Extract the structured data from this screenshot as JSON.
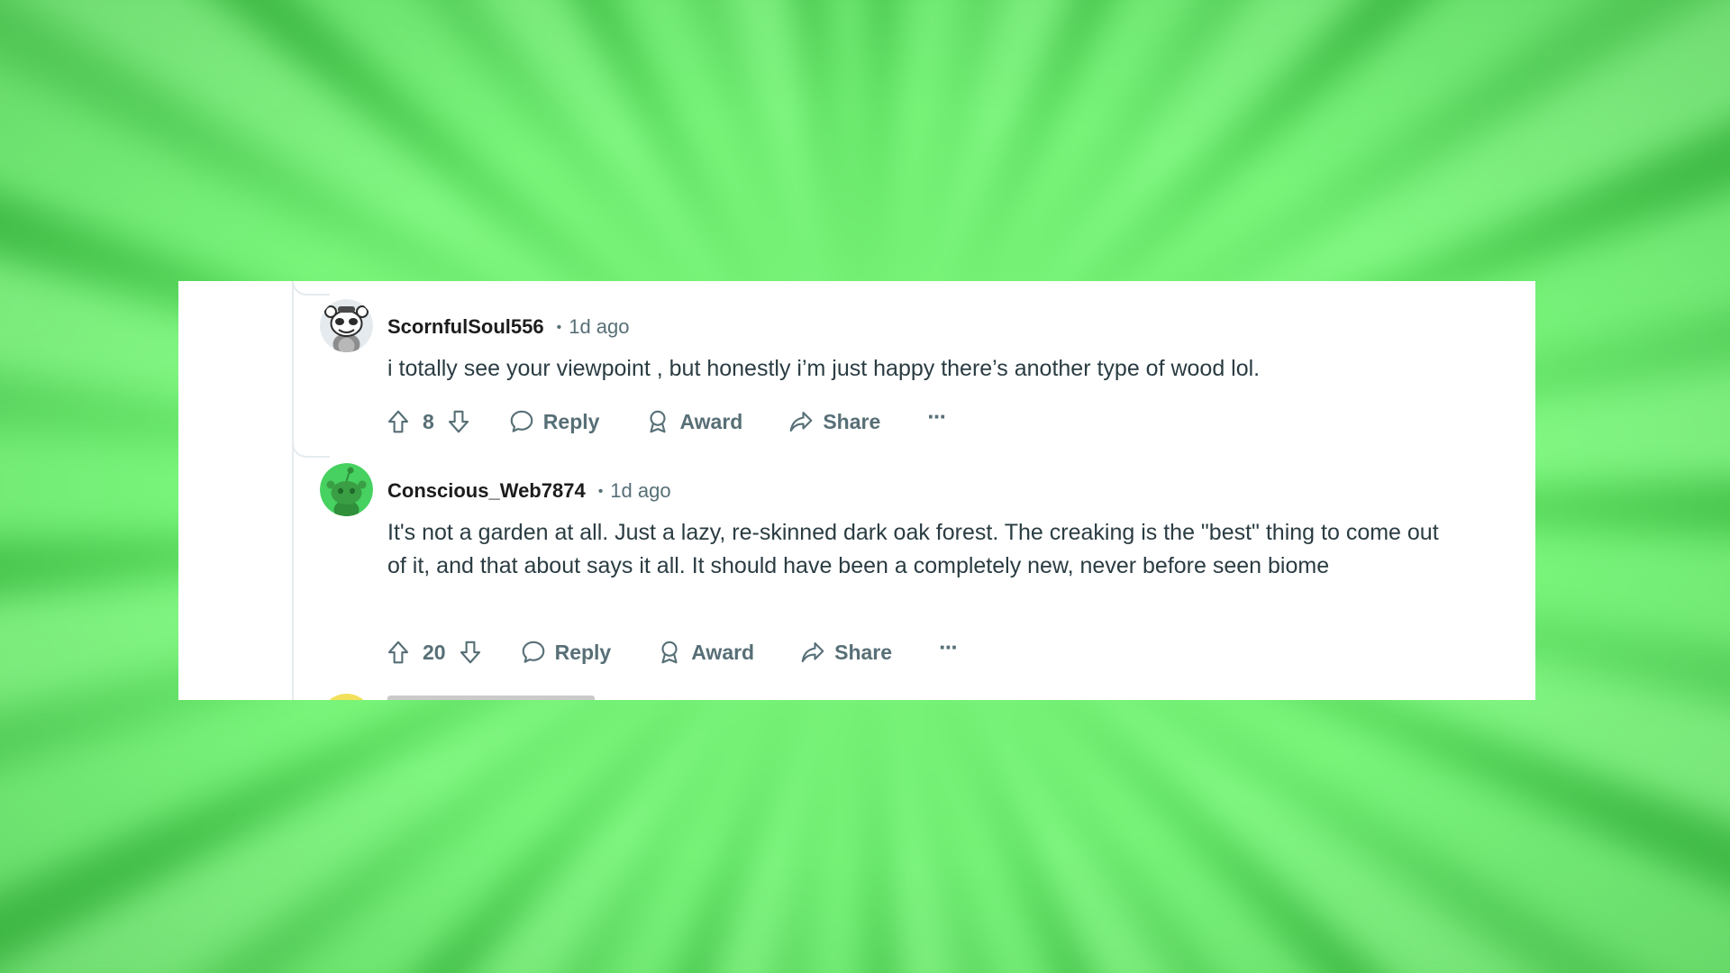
{
  "comments": [
    {
      "username": "ScornfulSoul556",
      "separator": "•",
      "time": "1d ago",
      "body": "i totally see your viewpoint , but honestly i’m just happy there’s another type of wood lol.",
      "votes": "8",
      "reply_label": "Reply",
      "award_label": "Award",
      "share_label": "Share",
      "more_label": "···",
      "avatar_icon": "robot-snoo-avatar-icon"
    },
    {
      "username": "Conscious_Web7874",
      "separator": "•",
      "time": "1d ago",
      "body": "It's not a garden at all. Just a lazy, re-skinned dark oak forest. The creaking is the \"best\" thing to come out of it, and that about says it all. It should have been a completely new, never before seen biome",
      "votes": "20",
      "reply_label": "Reply",
      "award_label": "Award",
      "share_label": "Share",
      "more_label": "···",
      "avatar_icon": "green-snoo-avatar-icon"
    }
  ],
  "colors": {
    "background": "#5fd964",
    "card": "#ffffff",
    "text": "#2a3c42",
    "meta": "#576f76",
    "avatar_green": "#46d160",
    "avatar_gray": "#e4eaed"
  }
}
